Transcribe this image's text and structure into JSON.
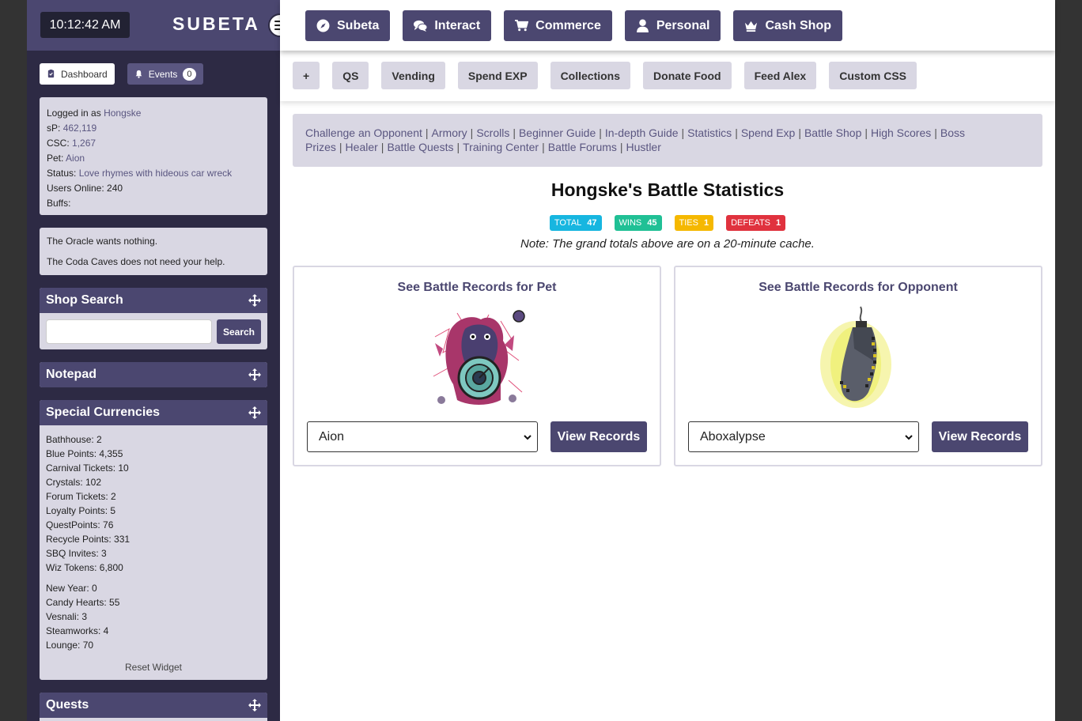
{
  "header": {
    "clock": "10:12:42 AM",
    "logo": "SUBETA",
    "nav": [
      {
        "label": "Subeta",
        "icon": "compass-icon"
      },
      {
        "label": "Interact",
        "icon": "chat-icon"
      },
      {
        "label": "Commerce",
        "icon": "cart-icon"
      },
      {
        "label": "Personal",
        "icon": "user-icon"
      },
      {
        "label": "Cash Shop",
        "icon": "crown-icon"
      }
    ],
    "quick_links": [
      "+",
      "QS",
      "Vending",
      "Spend EXP",
      "Collections",
      "Donate Food",
      "Feed Alex",
      "Custom CSS"
    ]
  },
  "sidebar": {
    "dashboard_label": "Dashboard",
    "events_label": "Events",
    "events_count": "0",
    "login": {
      "logged_in_label": "Logged in as",
      "username": "Hongske",
      "sp_label": "sP:",
      "sp": "462,119",
      "csc_label": "CSC:",
      "csc": "1,267",
      "pet_label": "Pet:",
      "pet": "Aion",
      "status_label": "Status:",
      "status": "Love rhymes with hideous car wreck",
      "users_online": "Users Online: 240",
      "buffs": "Buffs:"
    },
    "oracle": [
      "The Oracle wants nothing.",
      "The Coda Caves does not need your help."
    ],
    "shop_search": {
      "title": "Shop Search",
      "button": "Search",
      "placeholder": ""
    },
    "notepad_title": "Notepad",
    "currencies": {
      "title": "Special Currencies",
      "items": [
        "Bathhouse: 2",
        "Blue Points: 4,355",
        "Carnival Tickets: 10",
        "Crystals: 102",
        "Forum Tickets: 2",
        "Loyalty Points: 5",
        "QuestPoints: 76",
        "Recycle Points: 331",
        "SBQ Invites: 3",
        "Wiz Tokens: 6,800"
      ],
      "events": [
        "New Year: 0",
        "Candy Hearts: 55",
        "Vesnali: 3",
        "Steamworks: 4",
        "Lounge: 70"
      ],
      "reset": "Reset Widget"
    },
    "quests_title": "Quests"
  },
  "main": {
    "battle_links": [
      "Challenge an Opponent",
      "Armory",
      "Scrolls",
      "Beginner Guide",
      "In-depth Guide",
      "Statistics",
      "Spend Exp",
      "Battle Shop",
      "High Scores",
      "Boss Prizes",
      "Healer",
      "Battle Quests",
      "Training Center",
      "Battle Forums",
      "Hustler"
    ],
    "title": "Hongske's Battle Statistics",
    "stats": [
      {
        "label": "TOTAL",
        "value": "47",
        "color": "#17b6e0"
      },
      {
        "label": "WINS",
        "value": "45",
        "color": "#20c095"
      },
      {
        "label": "TIES",
        "value": "1",
        "color": "#f5b800"
      },
      {
        "label": "DEFEATS",
        "value": "1",
        "color": "#e0323e"
      }
    ],
    "note": "Note: The grand totals above are on a 20-minute cache.",
    "pet_card": {
      "title": "See Battle Records for Pet",
      "selected": "Aion",
      "button": "View Records"
    },
    "opp_card": {
      "title": "See Battle Records for Opponent",
      "selected": "Aboxalypse",
      "button": "View Records"
    }
  }
}
